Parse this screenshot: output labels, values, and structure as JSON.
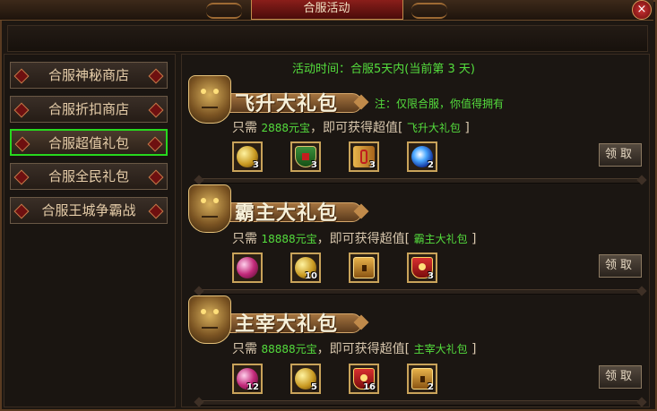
{
  "window": {
    "title": "合服活动",
    "close_label": "×"
  },
  "sidebar": {
    "items": [
      {
        "label": "合服神秘商店",
        "active": false
      },
      {
        "label": "合服折扣商店",
        "active": false
      },
      {
        "label": "合服超值礼包",
        "active": true
      },
      {
        "label": "合服全民礼包",
        "active": false
      },
      {
        "label": "合服王城争霸战",
        "active": false
      }
    ]
  },
  "activity": {
    "time_text": "活动时间：合服5天内(当前第 3 天)",
    "note": "注：仅限合服，你值得拥有"
  },
  "packs": [
    {
      "title": "飞升大礼包",
      "desc_prefix": "只需",
      "price": "2888元宝",
      "desc_middle": "，即可获得超值",
      "bracket_open": "[",
      "pack_name": "飞升大礼包",
      "bracket_close": "]",
      "claim_label": "领取",
      "items": [
        {
          "icon": "gold-orb-icon",
          "count": "3"
        },
        {
          "icon": "shield-token-icon",
          "count": "3"
        },
        {
          "icon": "scroll-icon",
          "count": "3"
        },
        {
          "icon": "blue-orb-icon",
          "count": "2"
        }
      ]
    },
    {
      "title": "霸主大礼包",
      "desc_prefix": "只需",
      "price": "18888元宝",
      "desc_middle": "，即可获得超值",
      "bracket_open": "[",
      "pack_name": "霸主大礼包",
      "bracket_close": "]",
      "claim_label": "领取",
      "items": [
        {
          "icon": "purple-orb-icon",
          "count": ""
        },
        {
          "icon": "gold-orb-icon",
          "count": "10"
        },
        {
          "icon": "treasure-chest-icon",
          "count": ""
        },
        {
          "icon": "red-banner-icon",
          "count": "3"
        }
      ]
    },
    {
      "title": "主宰大礼包",
      "desc_prefix": "只需",
      "price": "88888元宝",
      "desc_middle": "，即可获得超值",
      "bracket_open": "[",
      "pack_name": "主宰大礼包",
      "bracket_close": "]",
      "claim_label": "领取",
      "items": [
        {
          "icon": "purple-orb-icon",
          "count": "12"
        },
        {
          "icon": "gold-orb-icon",
          "count": "5"
        },
        {
          "icon": "red-banner-icon",
          "count": "16"
        },
        {
          "icon": "treasure-chest-icon",
          "count": "2"
        }
      ]
    }
  ]
}
